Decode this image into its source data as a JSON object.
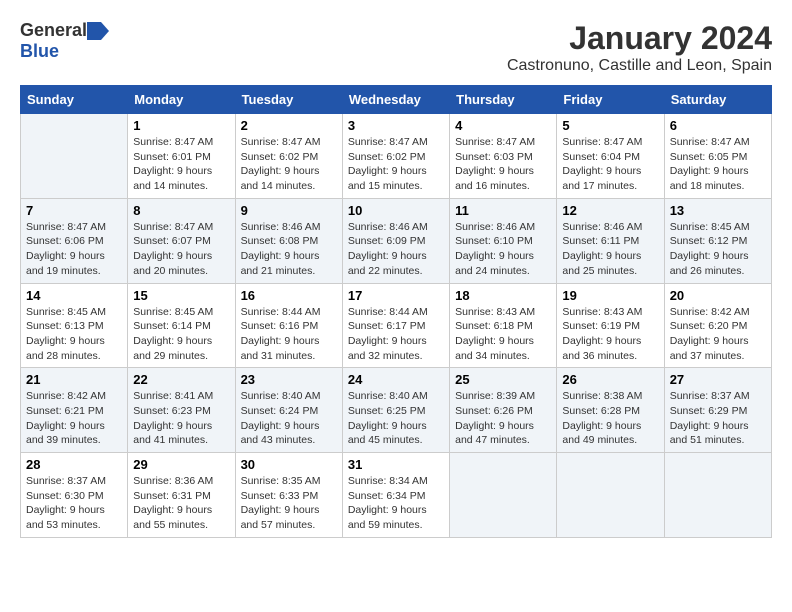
{
  "logo": {
    "general": "General",
    "blue": "Blue"
  },
  "title": "January 2024",
  "subtitle": "Castronuno, Castille and Leon, Spain",
  "days_of_week": [
    "Sunday",
    "Monday",
    "Tuesday",
    "Wednesday",
    "Thursday",
    "Friday",
    "Saturday"
  ],
  "weeks": [
    [
      {
        "day": "",
        "info": ""
      },
      {
        "day": "1",
        "info": "Sunrise: 8:47 AM\nSunset: 6:01 PM\nDaylight: 9 hours\nand 14 minutes."
      },
      {
        "day": "2",
        "info": "Sunrise: 8:47 AM\nSunset: 6:02 PM\nDaylight: 9 hours\nand 14 minutes."
      },
      {
        "day": "3",
        "info": "Sunrise: 8:47 AM\nSunset: 6:02 PM\nDaylight: 9 hours\nand 15 minutes."
      },
      {
        "day": "4",
        "info": "Sunrise: 8:47 AM\nSunset: 6:03 PM\nDaylight: 9 hours\nand 16 minutes."
      },
      {
        "day": "5",
        "info": "Sunrise: 8:47 AM\nSunset: 6:04 PM\nDaylight: 9 hours\nand 17 minutes."
      },
      {
        "day": "6",
        "info": "Sunrise: 8:47 AM\nSunset: 6:05 PM\nDaylight: 9 hours\nand 18 minutes."
      }
    ],
    [
      {
        "day": "7",
        "info": "Sunrise: 8:47 AM\nSunset: 6:06 PM\nDaylight: 9 hours\nand 19 minutes."
      },
      {
        "day": "8",
        "info": "Sunrise: 8:47 AM\nSunset: 6:07 PM\nDaylight: 9 hours\nand 20 minutes."
      },
      {
        "day": "9",
        "info": "Sunrise: 8:46 AM\nSunset: 6:08 PM\nDaylight: 9 hours\nand 21 minutes."
      },
      {
        "day": "10",
        "info": "Sunrise: 8:46 AM\nSunset: 6:09 PM\nDaylight: 9 hours\nand 22 minutes."
      },
      {
        "day": "11",
        "info": "Sunrise: 8:46 AM\nSunset: 6:10 PM\nDaylight: 9 hours\nand 24 minutes."
      },
      {
        "day": "12",
        "info": "Sunrise: 8:46 AM\nSunset: 6:11 PM\nDaylight: 9 hours\nand 25 minutes."
      },
      {
        "day": "13",
        "info": "Sunrise: 8:45 AM\nSunset: 6:12 PM\nDaylight: 9 hours\nand 26 minutes."
      }
    ],
    [
      {
        "day": "14",
        "info": "Sunrise: 8:45 AM\nSunset: 6:13 PM\nDaylight: 9 hours\nand 28 minutes."
      },
      {
        "day": "15",
        "info": "Sunrise: 8:45 AM\nSunset: 6:14 PM\nDaylight: 9 hours\nand 29 minutes."
      },
      {
        "day": "16",
        "info": "Sunrise: 8:44 AM\nSunset: 6:16 PM\nDaylight: 9 hours\nand 31 minutes."
      },
      {
        "day": "17",
        "info": "Sunrise: 8:44 AM\nSunset: 6:17 PM\nDaylight: 9 hours\nand 32 minutes."
      },
      {
        "day": "18",
        "info": "Sunrise: 8:43 AM\nSunset: 6:18 PM\nDaylight: 9 hours\nand 34 minutes."
      },
      {
        "day": "19",
        "info": "Sunrise: 8:43 AM\nSunset: 6:19 PM\nDaylight: 9 hours\nand 36 minutes."
      },
      {
        "day": "20",
        "info": "Sunrise: 8:42 AM\nSunset: 6:20 PM\nDaylight: 9 hours\nand 37 minutes."
      }
    ],
    [
      {
        "day": "21",
        "info": "Sunrise: 8:42 AM\nSunset: 6:21 PM\nDaylight: 9 hours\nand 39 minutes."
      },
      {
        "day": "22",
        "info": "Sunrise: 8:41 AM\nSunset: 6:23 PM\nDaylight: 9 hours\nand 41 minutes."
      },
      {
        "day": "23",
        "info": "Sunrise: 8:40 AM\nSunset: 6:24 PM\nDaylight: 9 hours\nand 43 minutes."
      },
      {
        "day": "24",
        "info": "Sunrise: 8:40 AM\nSunset: 6:25 PM\nDaylight: 9 hours\nand 45 minutes."
      },
      {
        "day": "25",
        "info": "Sunrise: 8:39 AM\nSunset: 6:26 PM\nDaylight: 9 hours\nand 47 minutes."
      },
      {
        "day": "26",
        "info": "Sunrise: 8:38 AM\nSunset: 6:28 PM\nDaylight: 9 hours\nand 49 minutes."
      },
      {
        "day": "27",
        "info": "Sunrise: 8:37 AM\nSunset: 6:29 PM\nDaylight: 9 hours\nand 51 minutes."
      }
    ],
    [
      {
        "day": "28",
        "info": "Sunrise: 8:37 AM\nSunset: 6:30 PM\nDaylight: 9 hours\nand 53 minutes."
      },
      {
        "day": "29",
        "info": "Sunrise: 8:36 AM\nSunset: 6:31 PM\nDaylight: 9 hours\nand 55 minutes."
      },
      {
        "day": "30",
        "info": "Sunrise: 8:35 AM\nSunset: 6:33 PM\nDaylight: 9 hours\nand 57 minutes."
      },
      {
        "day": "31",
        "info": "Sunrise: 8:34 AM\nSunset: 6:34 PM\nDaylight: 9 hours\nand 59 minutes."
      },
      {
        "day": "",
        "info": ""
      },
      {
        "day": "",
        "info": ""
      },
      {
        "day": "",
        "info": ""
      }
    ]
  ]
}
